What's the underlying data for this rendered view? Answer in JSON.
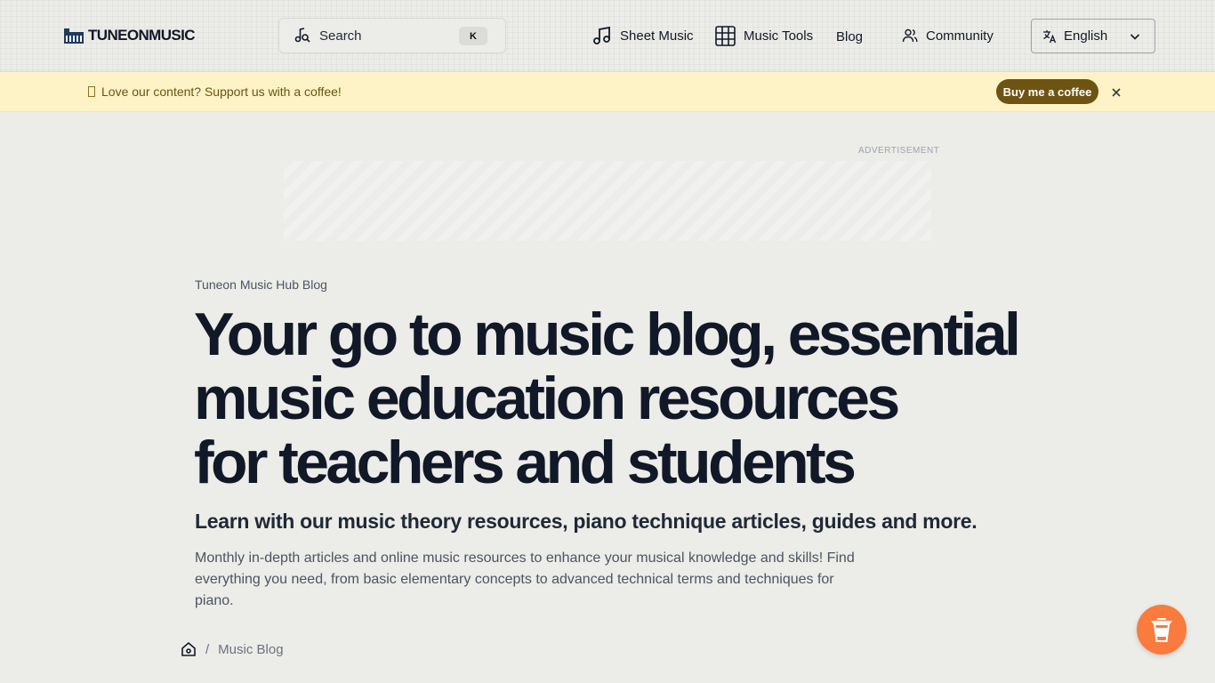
{
  "header": {
    "logo_text": "TUNEONMUSIC",
    "search_label": "Search",
    "search_shortcut": "K",
    "nav": {
      "sheet_music": "Sheet Music",
      "music_tools": "Music Tools",
      "blog": "Blog",
      "community": "Community"
    },
    "language": "English"
  },
  "banner": {
    "text": "Love our content? Support us with a coffee!",
    "button": "Buy me a coffee"
  },
  "ad": {
    "label": "ADVERTISEMENT"
  },
  "hero": {
    "eyebrow": "Tuneon Music Hub Blog",
    "title_line1": "Your go to music blog, essential",
    "title_line2": "music education resources",
    "title_line3": "for teachers and students",
    "subtitle": "Learn with our music theory resources, piano technique articles, guides and more.",
    "desc_line1": "Monthly in-depth articles and online music resources to enhance your musical knowledge and skills! Find",
    "desc_line2": "everything you need, from basic elementary concepts to advanced technical terms and techniques for piano."
  },
  "breadcrumb": {
    "separator": "/",
    "current": "Music Blog"
  },
  "colors": {
    "banner_bg": "#fdf3c7",
    "coffee_button": "#6e5411",
    "fab": "#f97b3d",
    "page_bg": "#ecece8"
  }
}
